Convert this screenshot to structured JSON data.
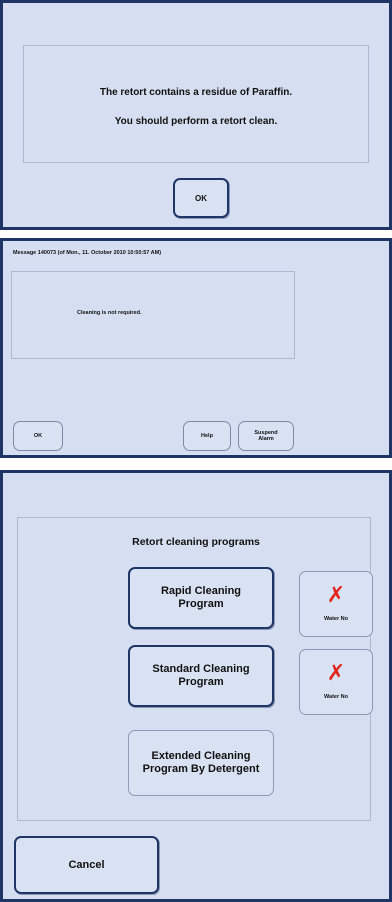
{
  "panel1": {
    "line1": "The retort contains a residue of Paraffin.",
    "line2": "You should perform a retort clean.",
    "ok_label": "OK"
  },
  "panel2": {
    "header": "Message 140073 (of Mon., 11. October 2010 10:50:57 AM)",
    "message": "Cleaning is not required.",
    "ok_label": "OK",
    "help_label": "Help",
    "suspend_label": "Suspend Alarm"
  },
  "panel3": {
    "title": "Retort cleaning programs",
    "rapid_label": "Rapid Cleaning Program",
    "standard_label": "Standard Cleaning Program",
    "extended_label": "Extended Cleaning Program By Detergent",
    "water1": {
      "mark": "✗",
      "label": "Water No"
    },
    "water2": {
      "mark": "✗",
      "label": "Water No"
    },
    "cancel_label": "Cancel",
    "colors": {
      "x_mark": "#e2261e",
      "border": "#1e3566",
      "background": "#d6dff1"
    }
  }
}
